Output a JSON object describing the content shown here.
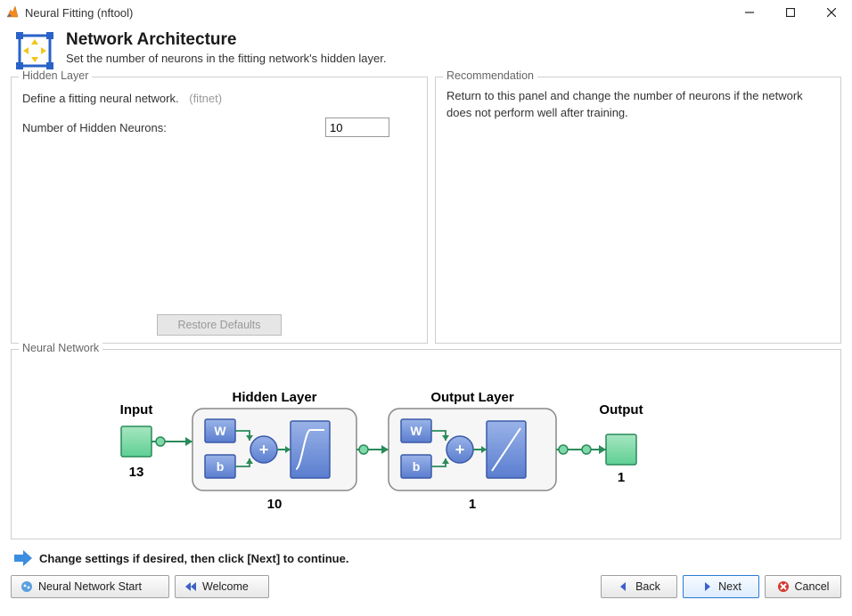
{
  "window": {
    "title": "Neural Fitting (nftool)"
  },
  "header": {
    "title": "Network Architecture",
    "subtitle": "Set the number of neurons in the fitting network's hidden layer."
  },
  "hiddenLayer": {
    "legend": "Hidden Layer",
    "defineText": "Define a fitting neural network.",
    "fnHint": "(fitnet)",
    "neuronsLabel": "Number of Hidden Neurons:",
    "neuronsValue": "10",
    "restoreLabel": "Restore Defaults"
  },
  "recommendation": {
    "legend": "Recommendation",
    "text": "Return to this panel and change the number of neurons if the network does not perform well after training."
  },
  "neuralNetwork": {
    "legend": "Neural Network",
    "input": {
      "label": "Input",
      "size": "13"
    },
    "hidden": {
      "label": "Hidden Layer",
      "size": "10",
      "w": "W",
      "b": "b",
      "plus": "+"
    },
    "output": {
      "label": "Output Layer",
      "size": "1",
      "w": "W",
      "b": "b",
      "plus": "+"
    },
    "out": {
      "label": "Output",
      "size": "1"
    }
  },
  "hint": {
    "text": "Change settings  if desired, then click [Next] to continue."
  },
  "buttons": {
    "start": "Neural Network Start",
    "welcome": "Welcome",
    "back": "Back",
    "next": "Next",
    "cancel": "Cancel"
  }
}
